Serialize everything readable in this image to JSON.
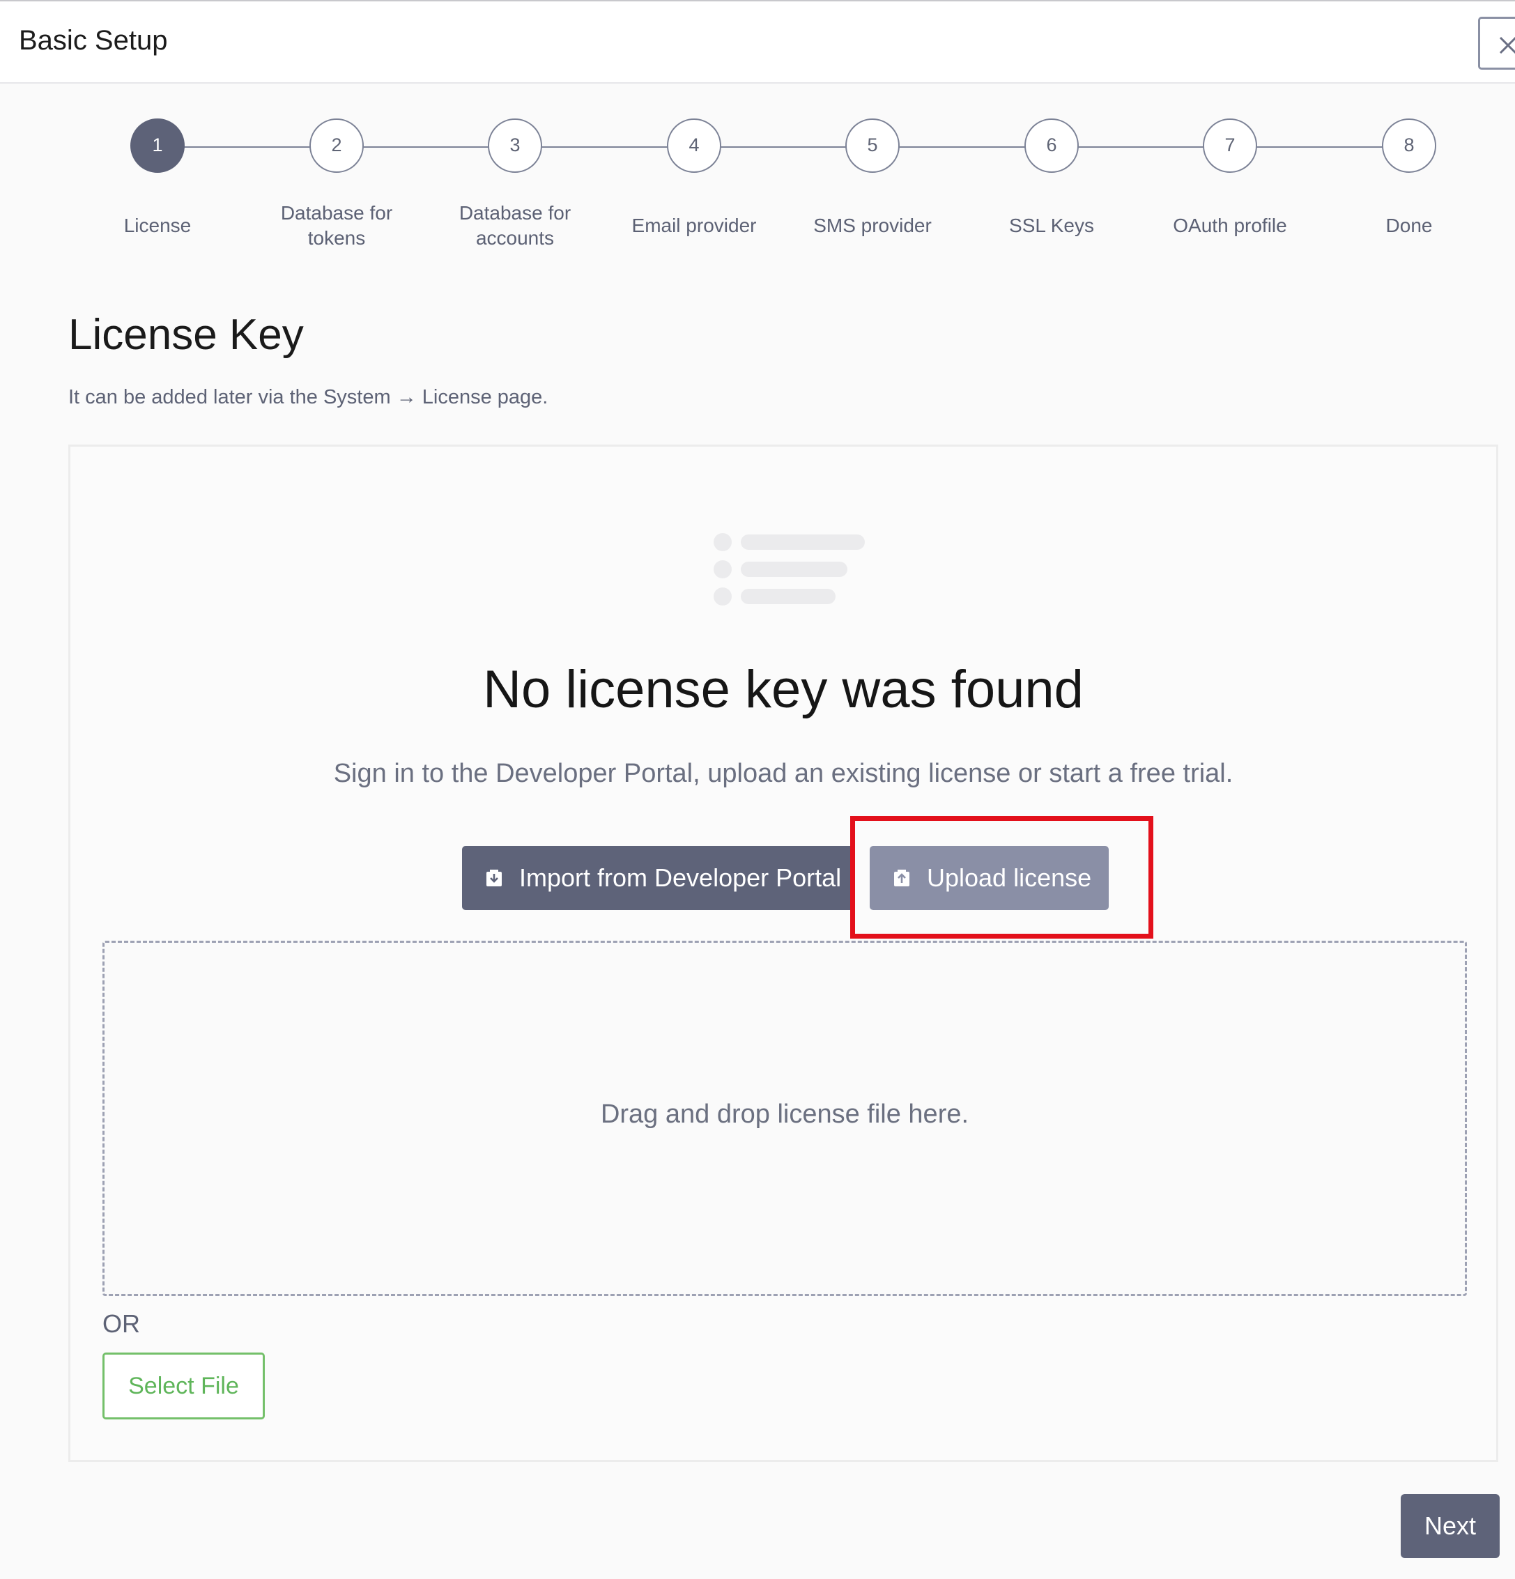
{
  "header": {
    "title": "Basic Setup",
    "close_icon": "close-icon"
  },
  "stepper": {
    "steps": [
      {
        "number": "1",
        "label": "License",
        "active": true
      },
      {
        "number": "2",
        "label": "Database for tokens",
        "active": false
      },
      {
        "number": "3",
        "label": "Database for accounts",
        "active": false
      },
      {
        "number": "4",
        "label": "Email provider",
        "active": false
      },
      {
        "number": "5",
        "label": "SMS provider",
        "active": false
      },
      {
        "number": "6",
        "label": "SSL Keys",
        "active": false
      },
      {
        "number": "7",
        "label": "OAuth profile",
        "active": false
      },
      {
        "number": "8",
        "label": "Done",
        "active": false
      }
    ]
  },
  "page": {
    "title": "License Key",
    "subtitle": "It can be added later via the System → License page."
  },
  "empty_state": {
    "illustration_icon": "list-placeholder-icon",
    "title": "No license key was found",
    "description": "Sign in to the Developer Portal, upload an existing license or start a free trial."
  },
  "actions": {
    "import_label": "Import from Developer Portal",
    "import_icon": "download-icon",
    "upload_label": "Upload license",
    "upload_icon": "upload-icon"
  },
  "dropzone": {
    "text": "Drag and drop license file here."
  },
  "alt_select": {
    "or_label": "OR",
    "select_file_label": "Select File"
  },
  "footer": {
    "next_label": "Next"
  },
  "colors": {
    "primary": "#5e6379",
    "secondary": "#8a8fa6",
    "success": "#5fb55a",
    "highlight": "#e3101b"
  }
}
